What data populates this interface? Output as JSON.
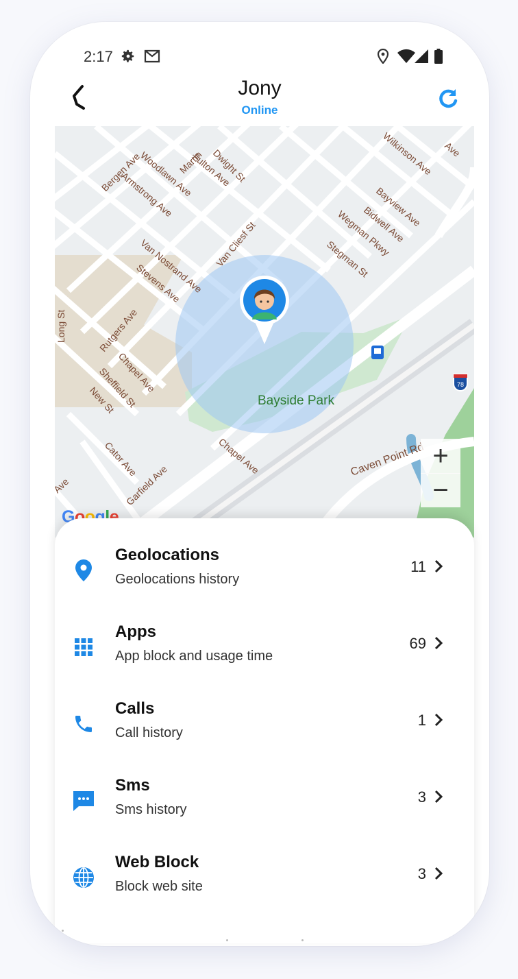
{
  "status_bar": {
    "time": "2:17",
    "left_icons": [
      "gear-icon",
      "gmail-icon"
    ],
    "right_icons": [
      "location-icon",
      "wifi-icon",
      "signal-icon",
      "battery-icon"
    ]
  },
  "header": {
    "name": "Jony",
    "status": "Online",
    "status_color": "#2196f3",
    "accent": "#2196f3"
  },
  "map": {
    "street_labels": [
      "Bergen Ave",
      "Martin",
      "Dwight St",
      "Woodlawn Ave",
      "Fulton Ave",
      "Armstrong Ave",
      "Van Cliesf St",
      "Van Nostrand Ave",
      "Stevens Ave",
      "Long St",
      "Rutgers Ave",
      "Chapel Ave",
      "Sheffield St",
      "New St",
      "Wilkinson Ave",
      "Bayview Ave",
      "Bidwell Ave",
      "Wegman Pkwy",
      "Stegman St",
      "Ave",
      "Cator Ave",
      "Garfield Ave",
      "Chapel Ave",
      "Caven Point Rd",
      "Ave"
    ],
    "park_label": "Bayside Park",
    "highway_shield": "78",
    "logo": "Google",
    "zoom_in": "+",
    "zoom_out": "−"
  },
  "menu": {
    "items": [
      {
        "title": "Geolocations",
        "subtitle": "Geolocations history",
        "count": "11",
        "icon": "location-pin-icon"
      },
      {
        "title": "Apps",
        "subtitle": "App block and usage time",
        "count": "69",
        "icon": "apps-grid-icon"
      },
      {
        "title": "Calls",
        "subtitle": "Call history",
        "count": "1",
        "icon": "phone-icon"
      },
      {
        "title": "Sms",
        "subtitle": "Sms history",
        "count": "3",
        "icon": "sms-icon"
      },
      {
        "title": "Web Block",
        "subtitle": "Block web site",
        "count": "3",
        "icon": "globe-icon"
      }
    ]
  }
}
